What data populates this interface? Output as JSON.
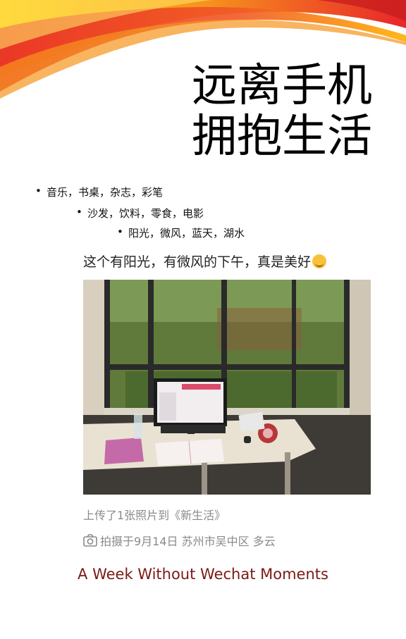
{
  "title": {
    "line1": "远离手机",
    "line2": "拥抱生活"
  },
  "bullets": {
    "level1": "音乐，书桌，杂志，彩笔",
    "level2": "沙发，饮料，零食，电影",
    "level3": "阳光，微风，蓝天，湖水"
  },
  "post": {
    "caption": "这个有阳光，有微风的下午，真是美好",
    "emoji": "smiling-face-icon",
    "upload_note": "上传了1张照片到《新生活》",
    "taken_info": "拍摄于9月14日 苏州市吴中区 多云",
    "camera_icon": "camera-icon"
  },
  "footer": {
    "text": "A Week Without Wechat Moments"
  },
  "colors": {
    "footer": "#7a1a14",
    "swoosh_red": "#e8262b",
    "swoosh_orange": "#f7941d",
    "swoosh_yellow": "#ffd200"
  }
}
